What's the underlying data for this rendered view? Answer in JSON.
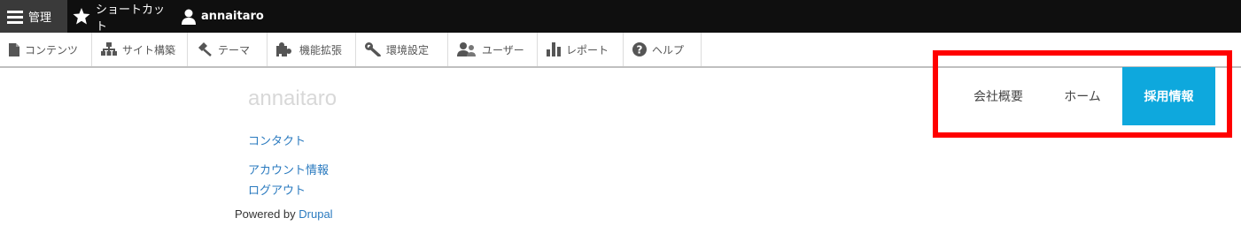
{
  "toolbar": {
    "items": [
      {
        "label": "管理",
        "icon": "hamburger-icon"
      },
      {
        "label": "ショートカット",
        "icon": "star-icon"
      },
      {
        "label": "annaitaro",
        "icon": "user-icon"
      }
    ]
  },
  "tray": {
    "items": [
      {
        "label": "コンテンツ",
        "icon": "file-icon"
      },
      {
        "label": "サイト構築",
        "icon": "sitemap-icon"
      },
      {
        "label": "テーマ",
        "icon": "paintbrush-icon"
      },
      {
        "label": "機能拡張",
        "icon": "puzzle-icon"
      },
      {
        "label": "環境設定",
        "icon": "wrench-icon"
      },
      {
        "label": "ユーザー",
        "icon": "people-icon"
      },
      {
        "label": "レポート",
        "icon": "bar-chart-icon"
      },
      {
        "label": "ヘルプ",
        "icon": "help-icon"
      }
    ]
  },
  "site": {
    "name": "annaitaro",
    "links": {
      "contact": "コンタクト",
      "account": "アカウント情報",
      "logout": "ログアウト"
    },
    "powered_prefix": "Powered by ",
    "powered_link": "Drupal"
  },
  "main_menu": {
    "items": [
      "会社概要",
      "ホーム",
      "採用情報"
    ],
    "active_color": "#0ea8dd",
    "highlight_color": "#ff0000"
  }
}
